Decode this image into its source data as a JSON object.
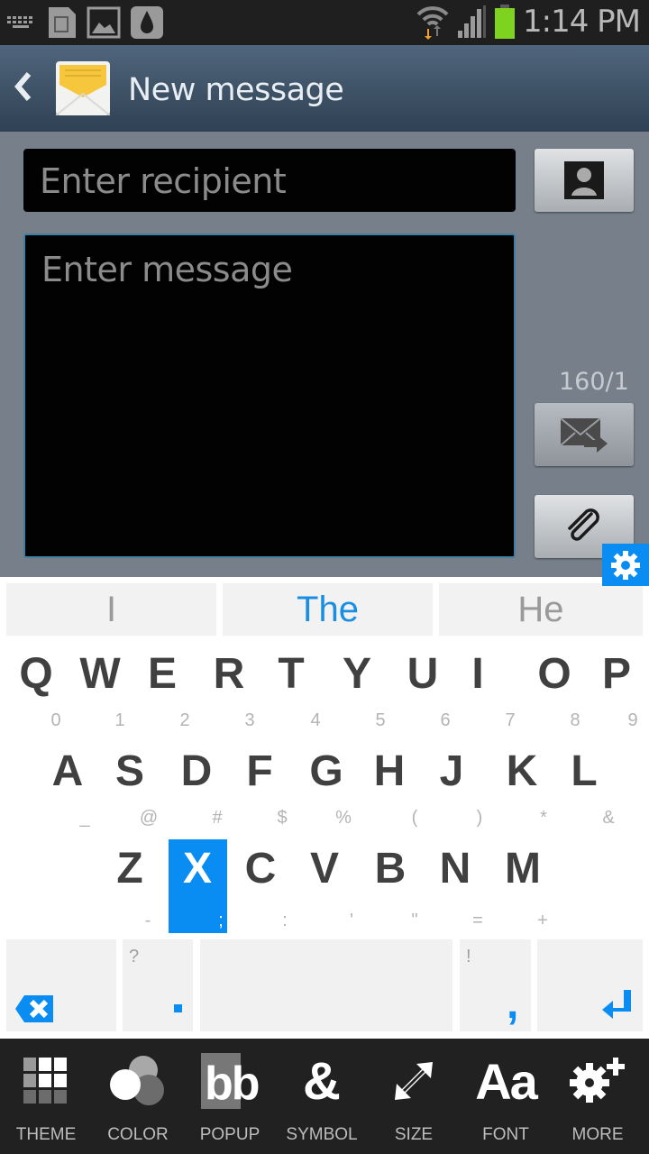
{
  "status_bar": {
    "left_icons": [
      "keyboard-icon",
      "sim-card-icon",
      "gallery-icon",
      "drop-app-icon"
    ],
    "right_icons": [
      "wifi-icon",
      "signal-icon",
      "battery-icon"
    ],
    "time": "1:14 PM",
    "battery_color": "#7ed321"
  },
  "title_bar": {
    "back_icon": "chevron-left-icon",
    "app_icon": "envelope-icon",
    "title": "New message"
  },
  "compose": {
    "recipient_placeholder": "Enter recipient",
    "message_placeholder": "Enter message",
    "char_counter": "160/1",
    "contact_button_icon": "contact-icon",
    "send_button_icon": "send-message-icon",
    "attach_button_icon": "paperclip-icon"
  },
  "keyboard": {
    "accent": "#0a8df3",
    "settings_icon": "gear-icon",
    "suggestions": [
      {
        "text": "I",
        "color": "#9a9a9a"
      },
      {
        "text": "The",
        "color": "#1a8ee0"
      },
      {
        "text": "He",
        "color": "#9a9a9a"
      }
    ],
    "rows": [
      {
        "keys": [
          "Q",
          "W",
          "E",
          "R",
          "T",
          "Y",
          "U",
          "I",
          "O",
          "P"
        ],
        "subs": [
          "0",
          "1",
          "2",
          "3",
          "4",
          "5",
          "6",
          "7",
          "8",
          "9"
        ]
      },
      {
        "keys": [
          "A",
          "S",
          "D",
          "F",
          "G",
          "H",
          "J",
          "K",
          "L"
        ],
        "subs": [
          "_",
          "@",
          "#",
          "$",
          "%",
          "(",
          ")",
          "*",
          "&"
        ]
      },
      {
        "keys": [
          "Z",
          "X",
          "C",
          "V",
          "B",
          "N",
          "M"
        ],
        "subs": [
          "-",
          ";",
          ":",
          "'",
          "\"",
          "=",
          "+"
        ]
      }
    ],
    "pressed_key": "X",
    "bottom_row": {
      "backspace_icon": "backspace-icon",
      "period_key": {
        "main": ".",
        "sub": "?"
      },
      "space_key": "",
      "comma_key": {
        "main": ",",
        "sub": "!"
      },
      "enter_icon": "enter-icon"
    }
  },
  "toolbar": {
    "items": [
      {
        "label": "THEME",
        "icon": "theme-grid-icon"
      },
      {
        "label": "COLOR",
        "icon": "color-circles-icon"
      },
      {
        "label": "POPUP",
        "icon": "popup-bb-icon",
        "glyph": "bb"
      },
      {
        "label": "SYMBOL",
        "icon": "ampersand-icon",
        "glyph": "&"
      },
      {
        "label": "SIZE",
        "icon": "resize-arrows-icon"
      },
      {
        "label": "FONT",
        "icon": "font-aa-icon",
        "glyph": "Aa"
      },
      {
        "label": "MORE",
        "icon": "gear-plus-icon"
      }
    ]
  }
}
